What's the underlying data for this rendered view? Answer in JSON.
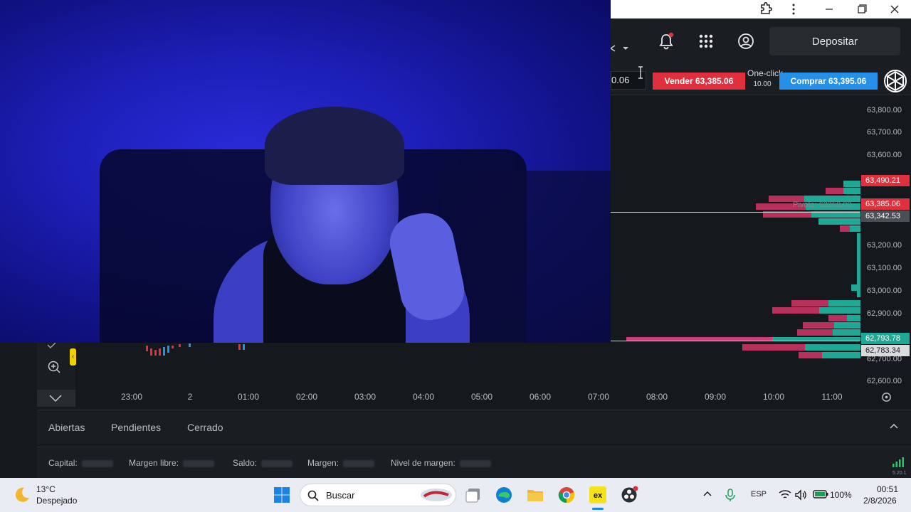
{
  "window": {
    "extension_icon": "extension-icon",
    "menu_icon": "kebab-menu-icon",
    "minimize_icon": "minimize-icon",
    "restore_icon": "restore-icon",
    "close_icon": "close-icon"
  },
  "header": {
    "bell_icon": "bell-icon",
    "apps_icon": "apps-grid-icon",
    "account_icon": "account-icon",
    "deposit_label": "Depositar",
    "notification_color": "#e0303e"
  },
  "orderbar": {
    "quantity_value": "0.06",
    "sell_label": "Vender 63,385.06",
    "buy_label": "Comprar 63,395.06",
    "oneclick_label": "One-click",
    "oneclick_value": "10.00",
    "sell_color": "#e0303e",
    "buy_color": "#2690e8"
  },
  "chart_data": {
    "type": "table",
    "price_ticks": [
      "63,800.00",
      "63,700.00",
      "63,600.00",
      "63,200.00",
      "63,100.00",
      "63,000.00",
      "62,900.00",
      "62,700.00",
      "62,600.00"
    ],
    "price_tags": [
      {
        "label": "63,490.21",
        "color": "#e0303e"
      },
      {
        "label": "63,385.06",
        "color": "#e0303e"
      },
      {
        "label": "63,342.53",
        "color": "#4a4f55"
      },
      {
        "label": "62,793.78",
        "color": "#1fa896"
      },
      {
        "label": "62,783.34",
        "color": "#d8dadc"
      }
    ],
    "pivot_label": "Pivote: 63350.00",
    "time_ticks": [
      "23:00",
      "2",
      "01:00",
      "02:00",
      "03:00",
      "04:00",
      "05:00",
      "06:00",
      "07:00",
      "08:00",
      "09:00",
      "10:00",
      "11:00"
    ]
  },
  "positions_panel": {
    "tabs": [
      "Abiertas",
      "Pendientes",
      "Cerrado"
    ],
    "collapse_icon": "chevron-up-icon"
  },
  "account_stats": {
    "capital_label": "Capital:",
    "free_margin_label": "Margen libre:",
    "balance_label": "Saldo:",
    "margin_label": "Margen:",
    "margin_level_label": "Nivel de margen:",
    "version": "5.20.1"
  },
  "taskbar": {
    "weather_temp": "13°C",
    "weather_desc": "Despejado",
    "search_placeholder": "Buscar",
    "language": "ESP",
    "battery": "100%",
    "time": "00:51",
    "date": "2/8/2026"
  }
}
